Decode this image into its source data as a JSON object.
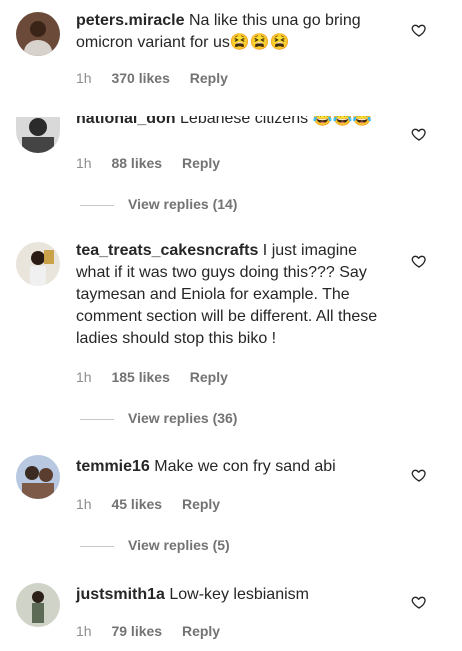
{
  "comments": [
    {
      "username": "peters.miracle",
      "text": "Na like this una go bring omicron variant for us😫😫😫",
      "time": "1h",
      "likes": "370 likes",
      "reply": "Reply"
    },
    {
      "username": "national_don",
      "text": "Lebanese citizens 😂😂😂",
      "time": "1h",
      "likes": "88 likes",
      "reply": "Reply",
      "view_replies": "View replies (14)"
    },
    {
      "username": "tea_treats_cakesncrafts",
      "text": "I just imagine what if it was two guys doing this??? Say taymesan and Eniola for example. The comment section will be different. All these ladies should stop this biko !",
      "time": "1h",
      "likes": "185 likes",
      "reply": "Reply",
      "view_replies": "View replies (36)"
    },
    {
      "username": "temmie16",
      "text": "Make we con fry sand abi",
      "time": "1h",
      "likes": "45 likes",
      "reply": "Reply",
      "view_replies": "View replies (5)"
    },
    {
      "username": "justsmith1a",
      "text": "Low-key lesbianism",
      "time": "1h",
      "likes": "79 likes",
      "reply": "Reply"
    }
  ],
  "icons": {
    "like": "heart-outline-icon"
  },
  "colors": {
    "meta": "#8e8e8e",
    "text": "#262626",
    "divider": "#c7c7c7"
  }
}
